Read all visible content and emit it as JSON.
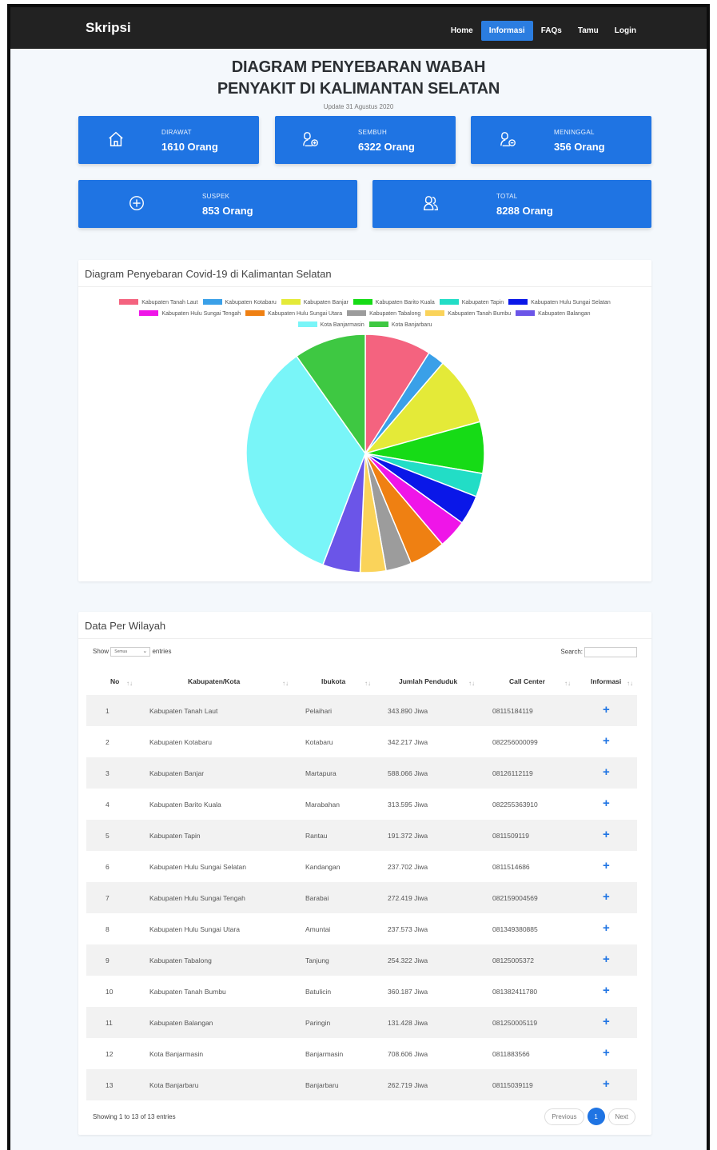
{
  "nav": {
    "brand": "Skripsi",
    "items": [
      {
        "label": "Home",
        "active": false
      },
      {
        "label": "Informasi",
        "active": true
      },
      {
        "label": "FAQs",
        "active": false
      },
      {
        "label": "Tamu",
        "active": false
      },
      {
        "label": "Login",
        "active": false
      }
    ]
  },
  "header": {
    "title_line1": "DIAGRAM PENYEBARAN WABAH",
    "title_line2": "PENYAKIT DI KALIMANTAN SELATAN",
    "update": "Update 31 Agustus 2020"
  },
  "stats": [
    {
      "label": "DIRAWAT",
      "value": "1610 Orang",
      "icon": "home-icon"
    },
    {
      "label": "SEMBUH",
      "value": "6322 Orang",
      "icon": "user-plus-icon"
    },
    {
      "label": "MENINGGAL",
      "value": "356 Orang",
      "icon": "user-minus-icon"
    },
    {
      "label": "SUSPEK",
      "value": "853 Orang",
      "icon": "circle-plus-icon"
    },
    {
      "label": "TOTAL",
      "value": "8288 Orang",
      "icon": "users-icon"
    }
  ],
  "chart_panel": {
    "title": "Diagram Penyebaran Covid-19 di Kalimantan Selatan"
  },
  "chart_data": {
    "type": "pie",
    "title": "",
    "series": [
      {
        "name": "Kabupaten Tanah Laut",
        "value": 9.0,
        "color": "#f4637f"
      },
      {
        "name": "Kabupaten Kotabaru",
        "value": 2.3,
        "color": "#3aa0e8"
      },
      {
        "name": "Kabupaten Banjar",
        "value": 9.4,
        "color": "#e4ea38"
      },
      {
        "name": "Kabupaten Barito Kuala",
        "value": 7.0,
        "color": "#16db16"
      },
      {
        "name": "Kabupaten Tapin",
        "value": 3.2,
        "color": "#22ddc6"
      },
      {
        "name": "Kabupaten Hulu Sungai Selatan",
        "value": 4.0,
        "color": "#0a17e8"
      },
      {
        "name": "Kabupaten Hulu Sungai Tengah",
        "value": 3.9,
        "color": "#ef15e8"
      },
      {
        "name": "Kabupaten Hulu Sungai Utara",
        "value": 4.9,
        "color": "#ef8012"
      },
      {
        "name": "Kabupaten Tabalong",
        "value": 3.5,
        "color": "#9c9c9c"
      },
      {
        "name": "Kabupaten Tanah Bumbu",
        "value": 3.5,
        "color": "#fad35a"
      },
      {
        "name": "Kabupaten Balangan",
        "value": 5.1,
        "color": "#6b55e8"
      },
      {
        "name": "Kota Banjarmasin",
        "value": 34.4,
        "color": "#79f5f8"
      },
      {
        "name": "Kota Banjarbaru",
        "value": 9.8,
        "color": "#3ec842"
      }
    ]
  },
  "table_panel": {
    "title": "Data Per Wilayah",
    "show_label": "Show",
    "show_value": "Semua",
    "entries_label": "entries",
    "search_label": "Search:",
    "columns": [
      "No",
      "Kabupaten/Kota",
      "Ibukota",
      "Jumlah Penduduk",
      "Call Center",
      "Informasi"
    ],
    "rows": [
      [
        "1",
        "Kabupaten Tanah Laut",
        "Pelaihari",
        "343.890 Jiwa",
        "08115184119"
      ],
      [
        "2",
        "Kabupaten Kotabaru",
        "Kotabaru",
        "342.217 Jiwa",
        "082256000099"
      ],
      [
        "3",
        "Kabupaten Banjar",
        "Martapura",
        "588.066 Jiwa",
        "08126112119"
      ],
      [
        "4",
        "Kabupaten Barito Kuala",
        "Marabahan",
        "313.595 Jiwa",
        "082255363910"
      ],
      [
        "5",
        "Kabupaten Tapin",
        "Rantau",
        "191.372 Jiwa",
        "0811509119"
      ],
      [
        "6",
        "Kabupaten Hulu Sungai Selatan",
        "Kandangan",
        "237.702 Jiwa",
        "0811514686"
      ],
      [
        "7",
        "Kabupaten Hulu Sungai Tengah",
        "Barabai",
        "272.419 Jiwa",
        "082159004569"
      ],
      [
        "8",
        "Kabupaten Hulu Sungai Utara",
        "Amuntai",
        "237.573 Jiwa",
        "081349380885"
      ],
      [
        "9",
        "Kabupaten Tabalong",
        "Tanjung",
        "254.322 Jiwa",
        "08125005372"
      ],
      [
        "10",
        "Kabupaten Tanah Bumbu",
        "Batulicin",
        "360.187 Jiwa",
        "081382411780"
      ],
      [
        "11",
        "Kabupaten Balangan",
        "Paringin",
        "131.428 Jiwa",
        "081250005119"
      ],
      [
        "12",
        "Kota Banjarmasin",
        "Banjarmasin",
        "708.606 Jiwa",
        "0811883566"
      ],
      [
        "13",
        "Kota Banjarbaru",
        "Banjarbaru",
        "262.719 Jiwa",
        "08115039119"
      ]
    ],
    "footer": "Showing 1 to 13 of 13 entries",
    "prev": "Previous",
    "page": "1",
    "next": "Next"
  }
}
